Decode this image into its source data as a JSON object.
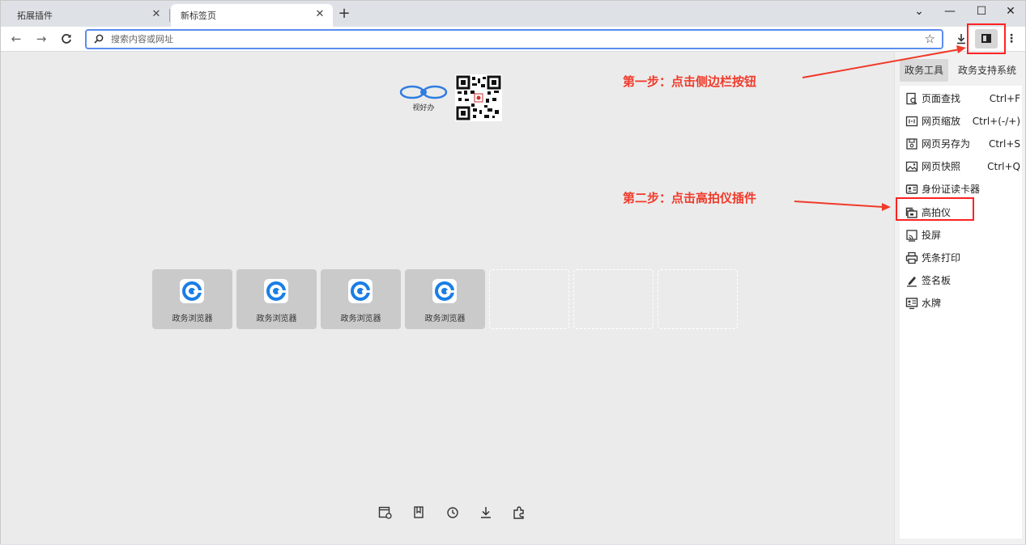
{
  "tabs": [
    {
      "label": "拓展插件",
      "active": false
    },
    {
      "label": "新标签页",
      "active": true
    }
  ],
  "new_tab_symbol": "+",
  "window_controls": {
    "collapse": "⌄",
    "minimize": "—",
    "maximize": "☐",
    "close": "✕"
  },
  "toolbar": {
    "back": "←",
    "forward": "→",
    "reload": "C",
    "search_placeholder": "搜索内容或网址",
    "star": "☆",
    "download": "⤓",
    "menu": "⋮"
  },
  "page": {
    "logo_text": "视好办",
    "tiles": [
      {
        "label": "政务浏览器",
        "empty": false
      },
      {
        "label": "政务浏览器",
        "empty": false
      },
      {
        "label": "政务浏览器",
        "empty": false
      },
      {
        "label": "政务浏览器",
        "empty": false
      },
      {
        "label": "",
        "empty": true
      },
      {
        "label": "",
        "empty": true
      },
      {
        "label": "",
        "empty": true
      }
    ],
    "bottom_icons": [
      "tab-settings-icon",
      "bookmarks-icon",
      "history-icon",
      "download-icon",
      "extensions-icon"
    ]
  },
  "sidebar": {
    "tabs": [
      {
        "label": "政务工具",
        "active": true
      },
      {
        "label": "政务支持系统",
        "active": false
      }
    ],
    "items": [
      {
        "label": "页面查找",
        "shortcut": "Ctrl+F",
        "icon": "page-find-icon"
      },
      {
        "label": "网页缩放",
        "shortcut": "Ctrl+(-/+)",
        "icon": "zoom-icon"
      },
      {
        "label": "网页另存为",
        "shortcut": "Ctrl+S",
        "icon": "save-as-icon"
      },
      {
        "label": "网页快照",
        "shortcut": "Ctrl+Q",
        "icon": "snapshot-icon"
      },
      {
        "label": "身份证读卡器",
        "shortcut": "",
        "icon": "id-card-icon"
      },
      {
        "label": "高拍仪",
        "shortcut": "",
        "icon": "scanner-icon"
      },
      {
        "label": "投屏",
        "shortcut": "",
        "icon": "cast-icon"
      },
      {
        "label": "凭条打印",
        "shortcut": "",
        "icon": "printer-icon"
      },
      {
        "label": "签名板",
        "shortcut": "",
        "icon": "signature-icon"
      },
      {
        "label": "水牌",
        "shortcut": "",
        "icon": "signboard-icon"
      }
    ]
  },
  "annotations": {
    "step1": "第一步：点击侧边栏按钮",
    "step2": "第二步：点击高拍仪插件",
    "color": "#f03a2a"
  },
  "colors": {
    "accent": "#5b8def",
    "browser_logo": "#1a7ee6"
  }
}
